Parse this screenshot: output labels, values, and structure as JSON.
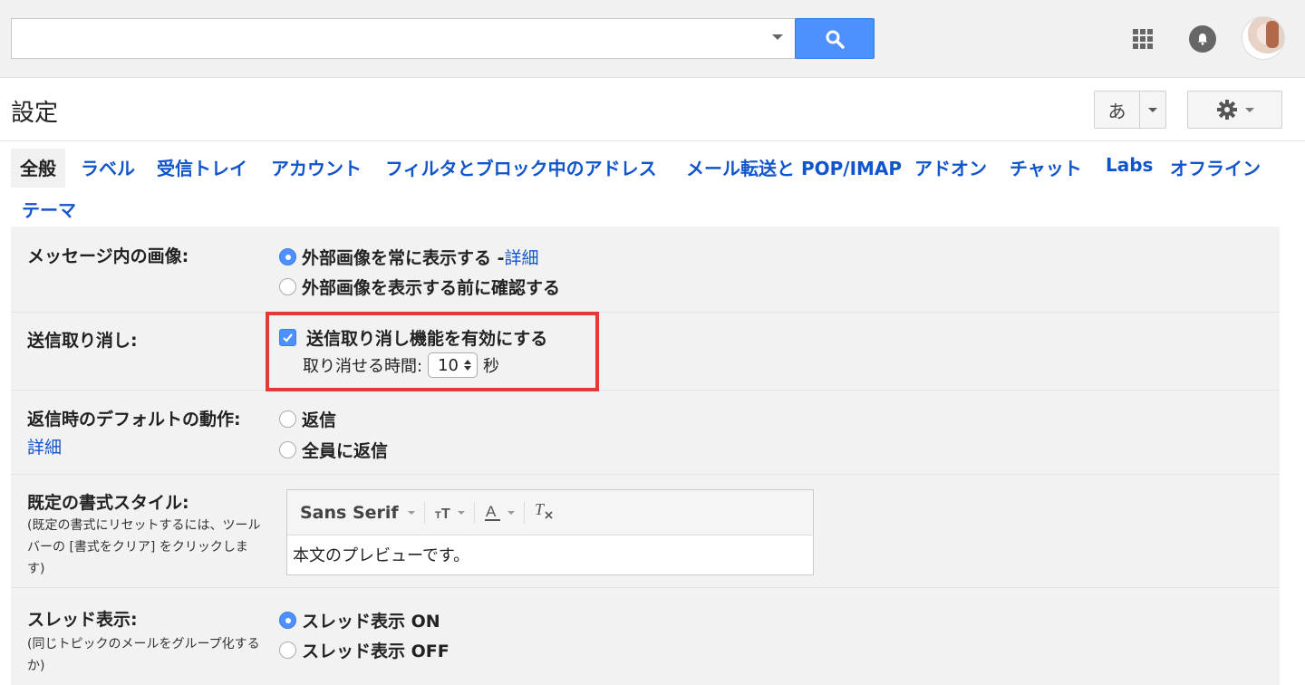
{
  "search": {
    "placeholder": ""
  },
  "header": {
    "title": "設定",
    "ime_label": "あ"
  },
  "tabs": [
    {
      "label": "全般",
      "active": true
    },
    {
      "label": "ラベル"
    },
    {
      "label": "受信トレイ"
    },
    {
      "label": "アカウント"
    },
    {
      "label": "フィルタとブロック中のアドレス"
    },
    {
      "label": "メール転送と POP/IMAP"
    },
    {
      "label": "アドオン"
    },
    {
      "label": "チャット"
    },
    {
      "label": "Labs"
    },
    {
      "label": "オフライン"
    },
    {
      "label": "テーマ"
    }
  ],
  "settings": {
    "images": {
      "label": "メッセージ内の画像:",
      "option1": "外部画像を常に表示する - ",
      "option1_link": "詳細",
      "option2": "外部画像を表示する前に確認する"
    },
    "undo_send": {
      "label": "送信取り消し:",
      "checkbox_label": "送信取り消し機能を有効にする",
      "period_label": "取り消せる時間:",
      "period_value": "10",
      "period_unit": "秒"
    },
    "reply": {
      "label": "返信時のデフォルトの動作:",
      "link": "詳細",
      "option1": "返信",
      "option2": "全員に返信"
    },
    "text_style": {
      "label": "既定の書式スタイル:",
      "note": "(既定の書式にリセットするには、ツールバーの [書式をクリア] をクリックします)",
      "font": "Sans Serif",
      "preview": "本文のプレビューです。"
    },
    "threading": {
      "label": "スレッド表示:",
      "note": "(同じトピックのメールをグループ化するか)",
      "option1": "スレッド表示 ON",
      "option2": "スレッド表示 OFF"
    }
  },
  "colors": {
    "accent": "#4d90fe",
    "link": "#1155cc",
    "highlight": "#e53935"
  }
}
